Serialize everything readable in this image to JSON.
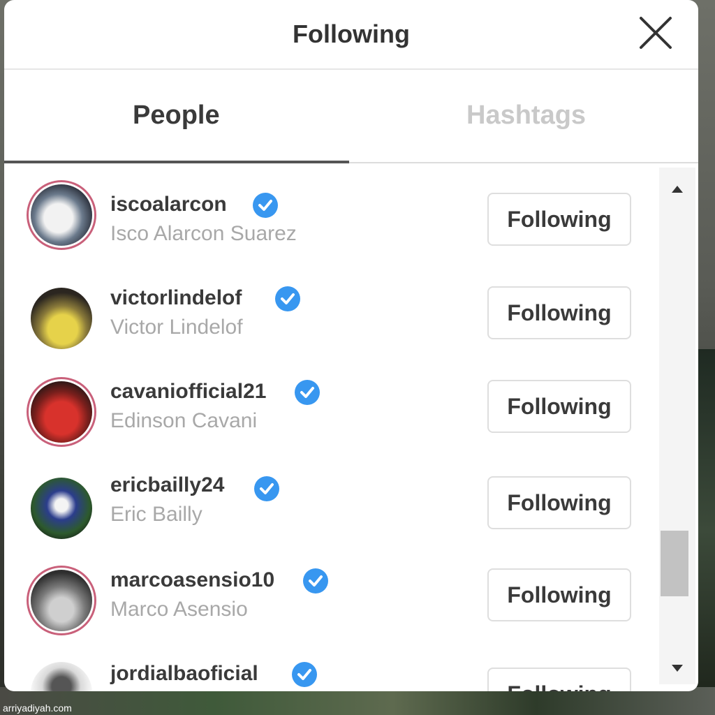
{
  "modal": {
    "title": "Following",
    "close_icon": "close-icon"
  },
  "tabs": [
    {
      "label": "People",
      "active": true
    },
    {
      "label": "Hashtags",
      "active": false
    }
  ],
  "accounts": [
    {
      "username": "iscoalarcon",
      "full_name": "Isco Alarcon Suarez",
      "button": "Following",
      "verified": true
    },
    {
      "username": "victorlindelof",
      "full_name": "Victor Lindelof",
      "button": "Following",
      "verified": true
    },
    {
      "username": "cavaniofficial21",
      "full_name": "Edinson Cavani",
      "button": "Following",
      "verified": true
    },
    {
      "username": "ericbailly24",
      "full_name": "Eric Bailly",
      "button": "Following",
      "verified": true
    },
    {
      "username": "marcoasensio10",
      "full_name": "Marco Asensio",
      "button": "Following",
      "verified": true
    },
    {
      "username": "jordialbaoficial",
      "full_name": "",
      "button": "Following",
      "verified": true
    }
  ],
  "colors": {
    "verified_blue": "#3897f0",
    "story_ring": "#c9607a"
  },
  "watermark": "arriyadiyah.com"
}
